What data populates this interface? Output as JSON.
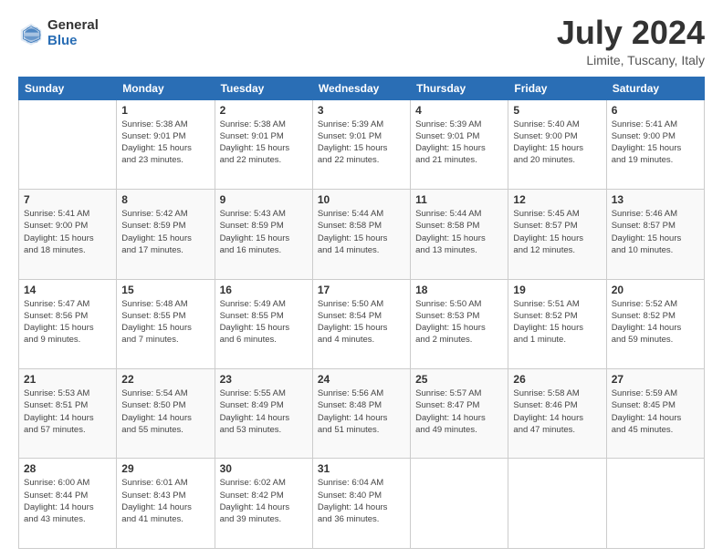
{
  "logo": {
    "general": "General",
    "blue": "Blue"
  },
  "title": "July 2024",
  "subtitle": "Limite, Tuscany, Italy",
  "days_header": [
    "Sunday",
    "Monday",
    "Tuesday",
    "Wednesday",
    "Thursday",
    "Friday",
    "Saturday"
  ],
  "weeks": [
    [
      {
        "day": "",
        "info": ""
      },
      {
        "day": "1",
        "info": "Sunrise: 5:38 AM\nSunset: 9:01 PM\nDaylight: 15 hours\nand 23 minutes."
      },
      {
        "day": "2",
        "info": "Sunrise: 5:38 AM\nSunset: 9:01 PM\nDaylight: 15 hours\nand 22 minutes."
      },
      {
        "day": "3",
        "info": "Sunrise: 5:39 AM\nSunset: 9:01 PM\nDaylight: 15 hours\nand 22 minutes."
      },
      {
        "day": "4",
        "info": "Sunrise: 5:39 AM\nSunset: 9:01 PM\nDaylight: 15 hours\nand 21 minutes."
      },
      {
        "day": "5",
        "info": "Sunrise: 5:40 AM\nSunset: 9:00 PM\nDaylight: 15 hours\nand 20 minutes."
      },
      {
        "day": "6",
        "info": "Sunrise: 5:41 AM\nSunset: 9:00 PM\nDaylight: 15 hours\nand 19 minutes."
      }
    ],
    [
      {
        "day": "7",
        "info": "Sunrise: 5:41 AM\nSunset: 9:00 PM\nDaylight: 15 hours\nand 18 minutes."
      },
      {
        "day": "8",
        "info": "Sunrise: 5:42 AM\nSunset: 8:59 PM\nDaylight: 15 hours\nand 17 minutes."
      },
      {
        "day": "9",
        "info": "Sunrise: 5:43 AM\nSunset: 8:59 PM\nDaylight: 15 hours\nand 16 minutes."
      },
      {
        "day": "10",
        "info": "Sunrise: 5:44 AM\nSunset: 8:58 PM\nDaylight: 15 hours\nand 14 minutes."
      },
      {
        "day": "11",
        "info": "Sunrise: 5:44 AM\nSunset: 8:58 PM\nDaylight: 15 hours\nand 13 minutes."
      },
      {
        "day": "12",
        "info": "Sunrise: 5:45 AM\nSunset: 8:57 PM\nDaylight: 15 hours\nand 12 minutes."
      },
      {
        "day": "13",
        "info": "Sunrise: 5:46 AM\nSunset: 8:57 PM\nDaylight: 15 hours\nand 10 minutes."
      }
    ],
    [
      {
        "day": "14",
        "info": "Sunrise: 5:47 AM\nSunset: 8:56 PM\nDaylight: 15 hours\nand 9 minutes."
      },
      {
        "day": "15",
        "info": "Sunrise: 5:48 AM\nSunset: 8:55 PM\nDaylight: 15 hours\nand 7 minutes."
      },
      {
        "day": "16",
        "info": "Sunrise: 5:49 AM\nSunset: 8:55 PM\nDaylight: 15 hours\nand 6 minutes."
      },
      {
        "day": "17",
        "info": "Sunrise: 5:50 AM\nSunset: 8:54 PM\nDaylight: 15 hours\nand 4 minutes."
      },
      {
        "day": "18",
        "info": "Sunrise: 5:50 AM\nSunset: 8:53 PM\nDaylight: 15 hours\nand 2 minutes."
      },
      {
        "day": "19",
        "info": "Sunrise: 5:51 AM\nSunset: 8:52 PM\nDaylight: 15 hours\nand 1 minute."
      },
      {
        "day": "20",
        "info": "Sunrise: 5:52 AM\nSunset: 8:52 PM\nDaylight: 14 hours\nand 59 minutes."
      }
    ],
    [
      {
        "day": "21",
        "info": "Sunrise: 5:53 AM\nSunset: 8:51 PM\nDaylight: 14 hours\nand 57 minutes."
      },
      {
        "day": "22",
        "info": "Sunrise: 5:54 AM\nSunset: 8:50 PM\nDaylight: 14 hours\nand 55 minutes."
      },
      {
        "day": "23",
        "info": "Sunrise: 5:55 AM\nSunset: 8:49 PM\nDaylight: 14 hours\nand 53 minutes."
      },
      {
        "day": "24",
        "info": "Sunrise: 5:56 AM\nSunset: 8:48 PM\nDaylight: 14 hours\nand 51 minutes."
      },
      {
        "day": "25",
        "info": "Sunrise: 5:57 AM\nSunset: 8:47 PM\nDaylight: 14 hours\nand 49 minutes."
      },
      {
        "day": "26",
        "info": "Sunrise: 5:58 AM\nSunset: 8:46 PM\nDaylight: 14 hours\nand 47 minutes."
      },
      {
        "day": "27",
        "info": "Sunrise: 5:59 AM\nSunset: 8:45 PM\nDaylight: 14 hours\nand 45 minutes."
      }
    ],
    [
      {
        "day": "28",
        "info": "Sunrise: 6:00 AM\nSunset: 8:44 PM\nDaylight: 14 hours\nand 43 minutes."
      },
      {
        "day": "29",
        "info": "Sunrise: 6:01 AM\nSunset: 8:43 PM\nDaylight: 14 hours\nand 41 minutes."
      },
      {
        "day": "30",
        "info": "Sunrise: 6:02 AM\nSunset: 8:42 PM\nDaylight: 14 hours\nand 39 minutes."
      },
      {
        "day": "31",
        "info": "Sunrise: 6:04 AM\nSunset: 8:40 PM\nDaylight: 14 hours\nand 36 minutes."
      },
      {
        "day": "",
        "info": ""
      },
      {
        "day": "",
        "info": ""
      },
      {
        "day": "",
        "info": ""
      }
    ]
  ]
}
